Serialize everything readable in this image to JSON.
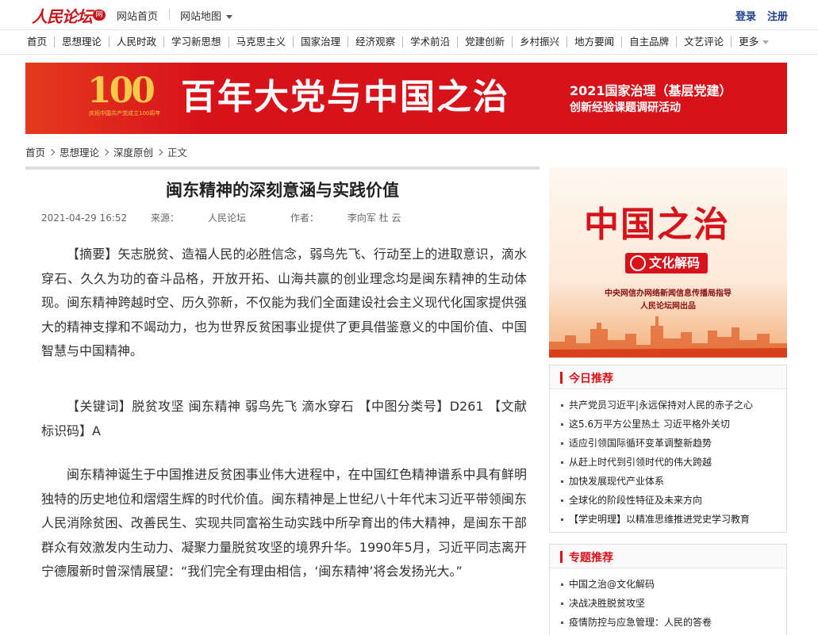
{
  "header": {
    "logo": "人民论坛",
    "logo_badge": "网",
    "home_link": "网站首页",
    "map_link": "网站地图",
    "login": "登录",
    "register": "注册"
  },
  "nav": {
    "items": [
      "首页",
      "思想理论",
      "人民时政",
      "学习新思想",
      "马克思主义",
      "国家治理",
      "经济观察",
      "学术前沿",
      "党建创新",
      "乡村振兴",
      "地方要闻",
      "自主品牌",
      "文艺评论"
    ],
    "more": "更多"
  },
  "banner": {
    "emblem_number": "100",
    "emblem_caption": "庆祝中国共产党成立100周年",
    "title": "百年大党与中国之治",
    "subtitle_1": "2021国家治理（基层党建）",
    "subtitle_2": "创新经验课题调研活动",
    "color": "#d8121a"
  },
  "breadcrumb": {
    "items": [
      "首页",
      "思想理论",
      "深度原创",
      "正文"
    ]
  },
  "article": {
    "title": "闽东精神的深刻意涵与实践价值",
    "date": "2021-04-29 16:52",
    "source_label": "来源：",
    "source": "人民论坛",
    "author_label": "作者：",
    "author": "李向军 杜 云",
    "paragraphs": [
      "【摘要】矢志脱贫、造福人民的必胜信念，弱鸟先飞、行动至上的进取意识，滴水穿石、久久为功的奋斗品格，开放开拓、山海共赢的创业理念均是闽东精神的生动体现。闽东精神跨越时空、历久弥新，不仅能为我们全面建设社会主义现代化国家提供强大的精神支撑和不竭动力，也为世界反贫困事业提供了更具借鉴意义的中国价值、中国智慧与中国精神。",
      "【关键词】脱贫攻坚 闽东精神 弱鸟先飞 滴水穿石 【中图分类号】D261 【文献标识码】A",
      "闽东精神诞生于中国推进反贫困事业伟大进程中，在中国红色精神谱系中具有鲜明独特的历史地位和熠熠生辉的时代价值。闽东精神是上世纪八十年代末习近平带领闽东人民消除贫困、改善民生、实现共同富裕生动实践中所孕育出的伟大精神，是闽东干部群众有效激发内生动力、凝聚力量脱贫攻坚的境界升华。1990年5月，习近平同志离开宁德履新时曾深情展望：“我们完全有理由相信，‘闽东精神’将会发扬光大。”"
    ]
  },
  "promo": {
    "title": "中国之治",
    "badge": "文化解码",
    "line_1": "中央网信办网络新闻信息传播局指导",
    "line_2": "人民论坛网出品"
  },
  "today": {
    "heading": "今日推荐",
    "items": [
      "共产党员习近平|永远保持对人民的赤子之心",
      "这5.6万平方公里热土 习近平格外关切",
      "适应引领国际循环变革调整新趋势",
      "从赶上时代到引领时代的伟大跨越",
      "加快发展现代产业体系",
      "全球化的阶段性特征及未来方向",
      "【学史明理】以精准思维推进党史学习教育"
    ]
  },
  "topic": {
    "heading": "专题推荐",
    "items": [
      "中国之治@文化解码",
      "决战决胜脱贫攻坚",
      "疫情防控与应急管理：人民的答卷"
    ]
  }
}
